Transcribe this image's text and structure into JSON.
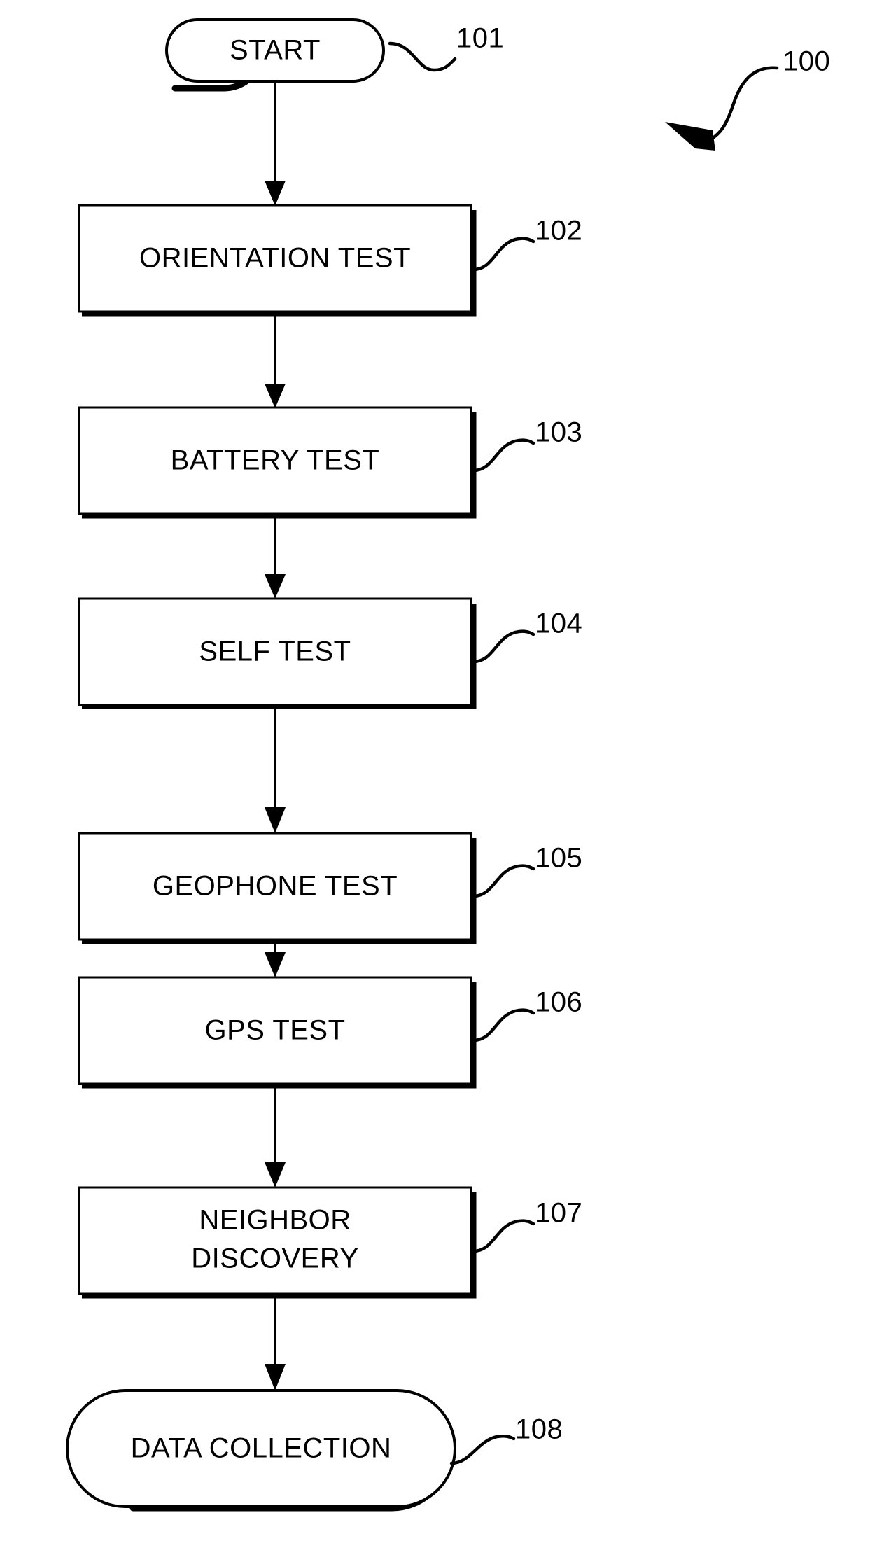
{
  "figure": {
    "figure_number": "100",
    "background_color": "#ffffff",
    "line_color": "#000000"
  },
  "nodes": [
    {
      "id": "start",
      "shape": "terminal",
      "label": "START",
      "ref": "101"
    },
    {
      "id": "orientation-test",
      "shape": "process",
      "label": "ORIENTATION TEST",
      "ref": "102"
    },
    {
      "id": "battery-test",
      "shape": "process",
      "label": "BATTERY TEST",
      "ref": "103"
    },
    {
      "id": "self-test",
      "shape": "process",
      "label": "SELF TEST",
      "ref": "104"
    },
    {
      "id": "geophone-test",
      "shape": "process",
      "label": "GEOPHONE TEST",
      "ref": "105"
    },
    {
      "id": "gps-test",
      "shape": "process",
      "label": "GPS TEST",
      "ref": "106"
    },
    {
      "id": "neighbor-discovery",
      "shape": "process",
      "label_line1": "NEIGHBOR",
      "label_line2": "DISCOVERY",
      "ref": "107"
    },
    {
      "id": "data-collection",
      "shape": "terminal",
      "label": "DATA COLLECTION",
      "ref": "108"
    }
  ],
  "refs": {
    "figure": "100",
    "start": "101",
    "orientation_test": "102",
    "battery_test": "103",
    "self_test": "104",
    "geophone_test": "105",
    "gps_test": "106",
    "neighbor_discovery": "107",
    "data_collection": "108"
  }
}
